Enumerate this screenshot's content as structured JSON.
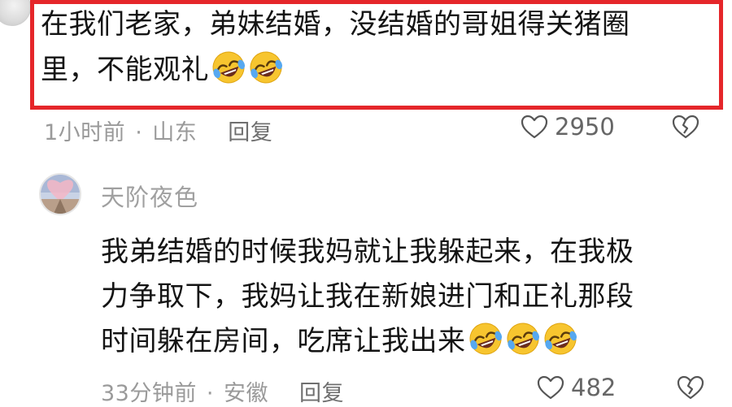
{
  "comments": [
    {
      "text_line1": "在我们老家，弟妹结婚，没结婚的哥姐得关猪圈",
      "text_line2": "里，不能观礼",
      "emoji_count": 2,
      "time": "1小时前",
      "separator": "·",
      "location": "山东",
      "reply_label": "回复",
      "likes": "2950",
      "highlight_color": "#e5262a"
    },
    {
      "username": "天阶夜色",
      "text_line1": "我弟结婚的时候我妈就让我躲起来，在我极",
      "text_line2": "力争取下，我妈让我在新娘进门和正礼那段",
      "text_line3": "时间躲在房间，吃席让我出来",
      "emoji_count": 3,
      "time": "33分钟前",
      "separator": "·",
      "location": "安徽",
      "reply_label": "回复",
      "likes": "482"
    }
  ],
  "icons": {
    "emoji": "rofl-emoji-icon",
    "like": "heart-outline-icon",
    "dislike": "broken-heart-icon"
  }
}
